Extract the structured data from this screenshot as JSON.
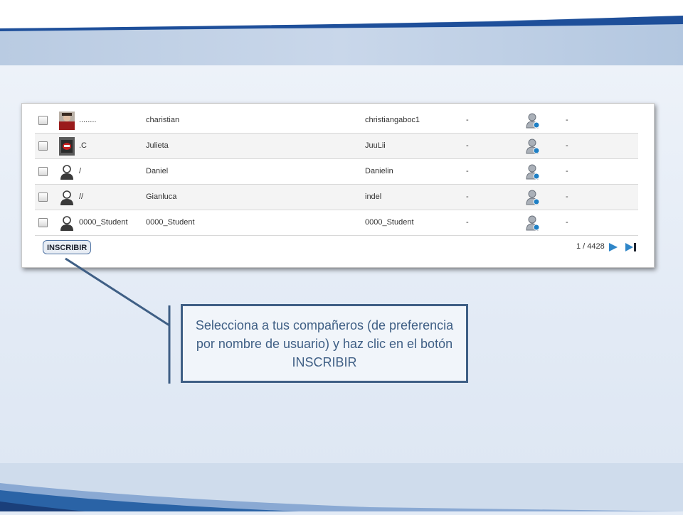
{
  "table": {
    "rows": [
      {
        "name1": "........",
        "name2": "charistian",
        "username": "christiangaboc1",
        "col4": "-",
        "col6": "-",
        "avatar": "photo-avatar"
      },
      {
        "name1": ".C",
        "name2": "Julieta",
        "username": "JuuLii",
        "col4": "-",
        "col6": "-",
        "avatar": "photo-avatar"
      },
      {
        "name1": "/",
        "name2": "Daniel",
        "username": "Danielin",
        "col4": "-",
        "col6": "-",
        "avatar": "default-user-icon"
      },
      {
        "name1": "//",
        "name2": "Gianluca",
        "username": "indel",
        "col4": "-",
        "col6": "-",
        "avatar": "default-user-icon"
      },
      {
        "name1": "0000_Student",
        "name2": "0000_Student",
        "username": "0000_Student",
        "col4": "-",
        "col6": "-",
        "avatar": "default-user-icon"
      }
    ]
  },
  "footer": {
    "enroll_label": "INSCRIBIR",
    "pager_text": "1 / 4428"
  },
  "callout": {
    "text": "Selecciona a tus compañeros (de preferencia por nombre de usuario) y haz clic en el botón INSCRIBIR"
  },
  "colors": {
    "accent": "#3f5f85",
    "banner_blue": "#2a63a6",
    "pager_arrow": "#2f86c8"
  },
  "icons": [
    "checkbox",
    "photo-avatar",
    "default-user-icon",
    "user-role-icon",
    "next-page-icon",
    "last-page-icon"
  ]
}
